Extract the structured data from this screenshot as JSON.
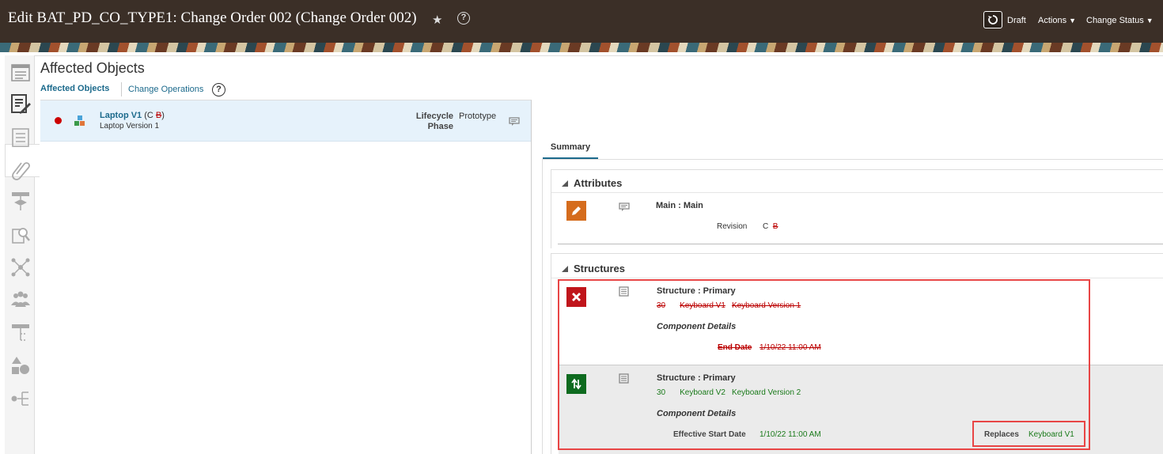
{
  "header": {
    "title": "Edit BAT_PD_CO_TYPE1: Change Order 002 (Change Order 002)",
    "star_glyph": "★",
    "help_glyph": "?",
    "draft_label": "Draft",
    "actions_label": "Actions",
    "change_status_label": "Change Status",
    "caret": "▼"
  },
  "left_rail": {
    "icons": [
      "overview-icon",
      "edit-document-icon",
      "checklist-icon",
      "attachment-icon",
      "workflow-icon",
      "search-document-icon",
      "network-icon",
      "people-icon",
      "hierarchy-icon",
      "shapes-icon",
      "relationship-icon"
    ]
  },
  "main": {
    "section_title": "Affected Objects",
    "tabs": [
      {
        "label": "Affected Objects"
      },
      {
        "label": "Change Operations"
      }
    ],
    "help_glyph": "?",
    "object": {
      "name": "Laptop V1",
      "rev_open": "(C",
      "rev_old": "B",
      "rev_close": ")",
      "description": "Laptop Version 1",
      "lifecycle_label_1": "Lifecycle",
      "lifecycle_label_2": "Phase",
      "lifecycle_value": "Prototype"
    }
  },
  "summary": {
    "tab_label": "Summary",
    "attributes": {
      "header": "Attributes",
      "group": "Main : Main",
      "revision_label": "Revision",
      "revision_new": "C",
      "revision_old": "B"
    },
    "structures": {
      "header": "Structures",
      "rows": [
        {
          "title": "Structure : Primary",
          "seq": "30",
          "item": "Keyboard V1",
          "item_desc": "Keyboard Version 1",
          "component_details": "Component Details",
          "date_label": "End Date",
          "date_value": "1/10/22 11:00 AM",
          "action": "delete"
        },
        {
          "title": "Structure : Primary",
          "seq": "30",
          "item": "Keyboard V2",
          "item_desc": "Keyboard Version 2",
          "component_details": "Component Details",
          "date_label": "Effective Start Date",
          "date_value": "1/10/22 11:00 AM",
          "replaces_label": "Replaces",
          "replaces_value": "Keyboard V1",
          "action": "replace"
        }
      ]
    }
  },
  "colors": {
    "header_bg": "#3b2f27",
    "link_blue": "#1c6a8c",
    "delete_red": "#c0151b",
    "add_green": "#0e6b1f",
    "edit_orange": "#d56c1d",
    "highlight_red": "#e84545",
    "selected_row_bg": "#e6f2fb"
  }
}
